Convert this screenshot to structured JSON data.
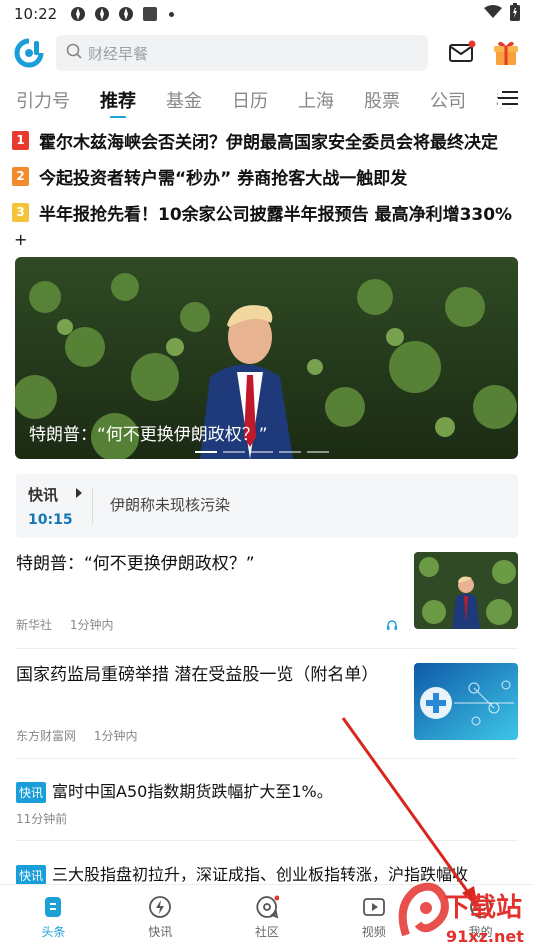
{
  "status": {
    "time": "10:22"
  },
  "header": {
    "search_placeholder": "财经早餐"
  },
  "tabs": [
    "引力号",
    "推荐",
    "基金",
    "日历",
    "上海",
    "股票",
    "公司",
    "科"
  ],
  "active_tab_index": 1,
  "hot": [
    {
      "rank": "1",
      "color": "#e83a2f",
      "text": "霍尔木兹海峡会否关闭？伊朗最高国家安全委员会将最终决定"
    },
    {
      "rank": "2",
      "color": "#f38a2c",
      "text": "今起投资者转户需“秒办” 券商抢客大战一触即发"
    },
    {
      "rank": "3",
      "color": "#f4c33a",
      "text": "半年报抢先看！10余家公司披露半年报预告 最高净利增330%"
    }
  ],
  "hot_more": "+",
  "banner": {
    "caption": "特朗普：“何不更换伊朗政权？”"
  },
  "flash": {
    "label": "快讯",
    "time": "10:15",
    "text": "伊朗称未现核污染"
  },
  "news": [
    {
      "title": "特朗普：“何不更换伊朗政权？”",
      "source": "新华社",
      "time": "1分钟内"
    },
    {
      "title": "国家药监局重磅举措 潜在受益股一览（附名单）",
      "source": "东方财富网",
      "time": "1分钟内"
    }
  ],
  "kuaixun": [
    {
      "tag": "快讯",
      "text": "富时中国A50指数期货跌幅扩大至1%。",
      "time": "11分钟前"
    },
    {
      "tag": "快讯",
      "text": "三大股指盘初拉升，深证成指、创业板指转涨，沪指跌幅收"
    }
  ],
  "bottom_nav": [
    "头条",
    "快讯",
    "社区",
    "视频",
    "我的"
  ],
  "watermark": {
    "big": "下载站",
    "small": "91xz.net"
  },
  "colors": {
    "accent": "#1ca0d6",
    "brand": "#16a5d5"
  }
}
